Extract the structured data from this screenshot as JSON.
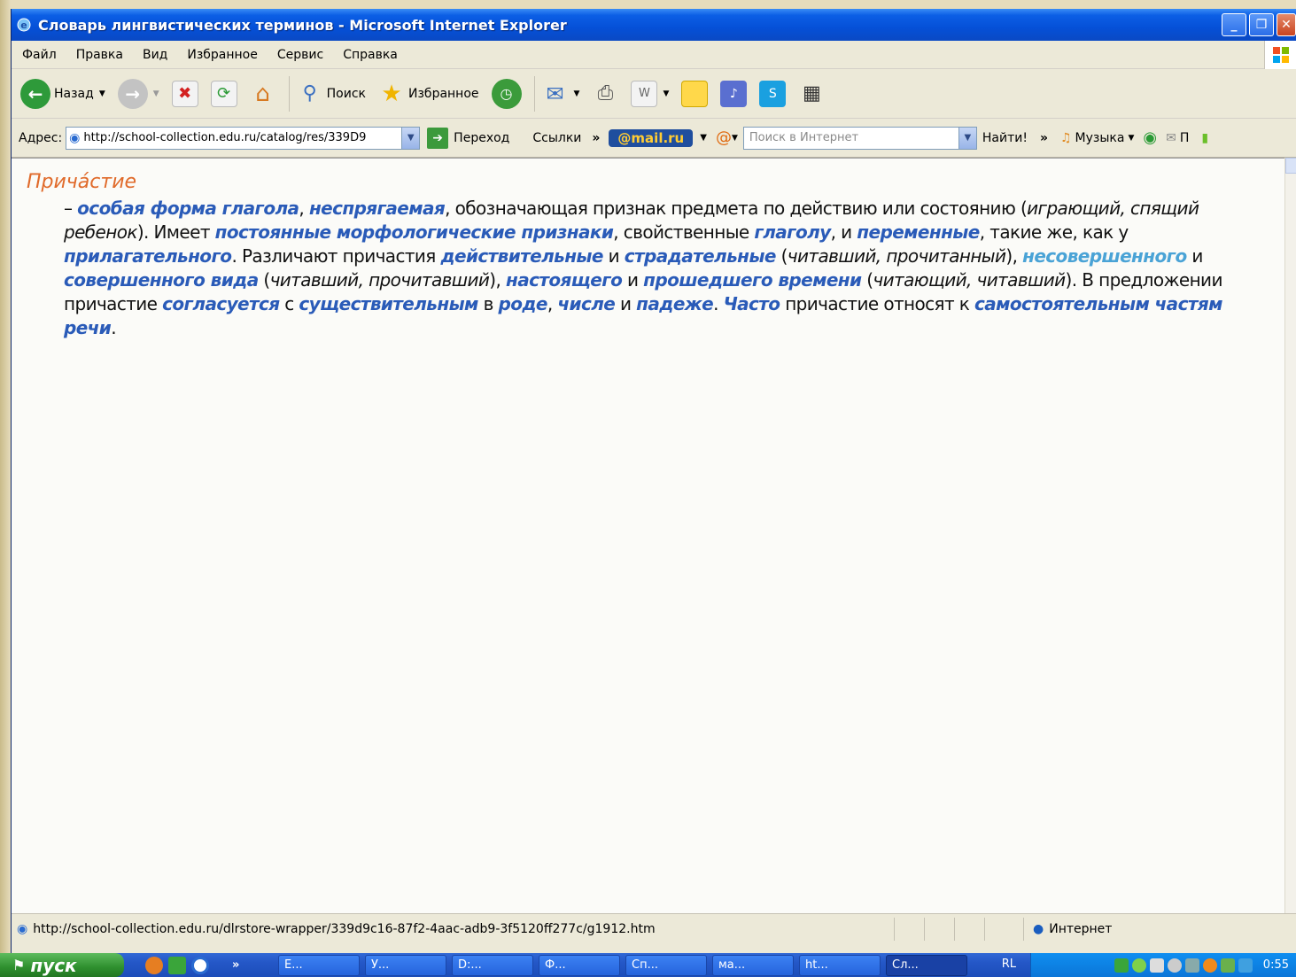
{
  "window": {
    "title": "Словарь лингвистических терминов - Microsoft Internet Explorer"
  },
  "menu": [
    "Файл",
    "Правка",
    "Вид",
    "Избранное",
    "Сервис",
    "Справка"
  ],
  "toolbar": {
    "back_label": "Назад",
    "search_label": "Поиск",
    "favorites_label": "Избранное"
  },
  "address": {
    "label": "Адрес:",
    "url": "http://school-collection.edu.ru/catalog/res/339D9",
    "go_label": "Переход",
    "links_label": "Ссылки",
    "mailru_label": "@mail.ru",
    "search_placeholder": "Поиск в Интернет",
    "find_label": "Найти!",
    "music_label": "Музыка",
    "mail_label": "П"
  },
  "article": {
    "term": "Причáстие",
    "definition": [
      {
        "t": "– "
      },
      {
        "l": "особая форма глагола"
      },
      {
        "t": ", "
      },
      {
        "l": "неспрягаемая"
      },
      {
        "t": ", обозначающая признак предмета по действию или состоянию ("
      },
      {
        "i": "играющий, спящий ребенок"
      },
      {
        "t": "). Имеет "
      },
      {
        "l": "постоянные морфологические признаки"
      },
      {
        "t": ", свойственные "
      },
      {
        "l": "глаголу"
      },
      {
        "t": ", и "
      },
      {
        "l": "переменные"
      },
      {
        "t": ", такие же, как у "
      },
      {
        "l": "прилагательного"
      },
      {
        "t": ". Различают причастия "
      },
      {
        "l": "действительные"
      },
      {
        "t": " и "
      },
      {
        "l": "страдательные"
      },
      {
        "t": " ("
      },
      {
        "i": "читавший, прочитанный"
      },
      {
        "t": "), "
      },
      {
        "l2": "несовершенного"
      },
      {
        "t": " и "
      },
      {
        "l": "совершенного вида"
      },
      {
        "t": " ("
      },
      {
        "i": "читавший, прочитавший"
      },
      {
        "t": "), "
      },
      {
        "l": "настоящего"
      },
      {
        "t": " и "
      },
      {
        "l": "прошедшего времени"
      },
      {
        "t": " ("
      },
      {
        "i": "читающий, читавший"
      },
      {
        "t": "). В предложении причастие "
      },
      {
        "l": "согласуется"
      },
      {
        "t": " с "
      },
      {
        "l": "существительным"
      },
      {
        "t": " в "
      },
      {
        "l": "роде"
      },
      {
        "t": ", "
      },
      {
        "l": "числе"
      },
      {
        "t": " и "
      },
      {
        "l": "падеже"
      },
      {
        "t": ". "
      },
      {
        "l": "Часто"
      },
      {
        "t": " причастие относят к "
      },
      {
        "l": "самостоятельным частям речи"
      },
      {
        "t": "."
      }
    ]
  },
  "status": {
    "url": "http://school-collection.edu.ru/dlrstore-wrapper/339d9c16-87f2-4aac-adb9-3f5120ff277c/g1912.htm",
    "zone": "Интернет"
  },
  "taskbar": {
    "start_label": "пуск",
    "tasks": [
      "E...",
      "У...",
      "D:...",
      "Ф...",
      "Сп...",
      "ма...",
      "ht...",
      "Сл..."
    ],
    "lang": "RL",
    "clock": "0:55"
  },
  "colors": {
    "term": "#e06a2a",
    "link": "#2a5bb8",
    "link_visited": "#4aa3d6",
    "titlebar": "#0550d7"
  }
}
